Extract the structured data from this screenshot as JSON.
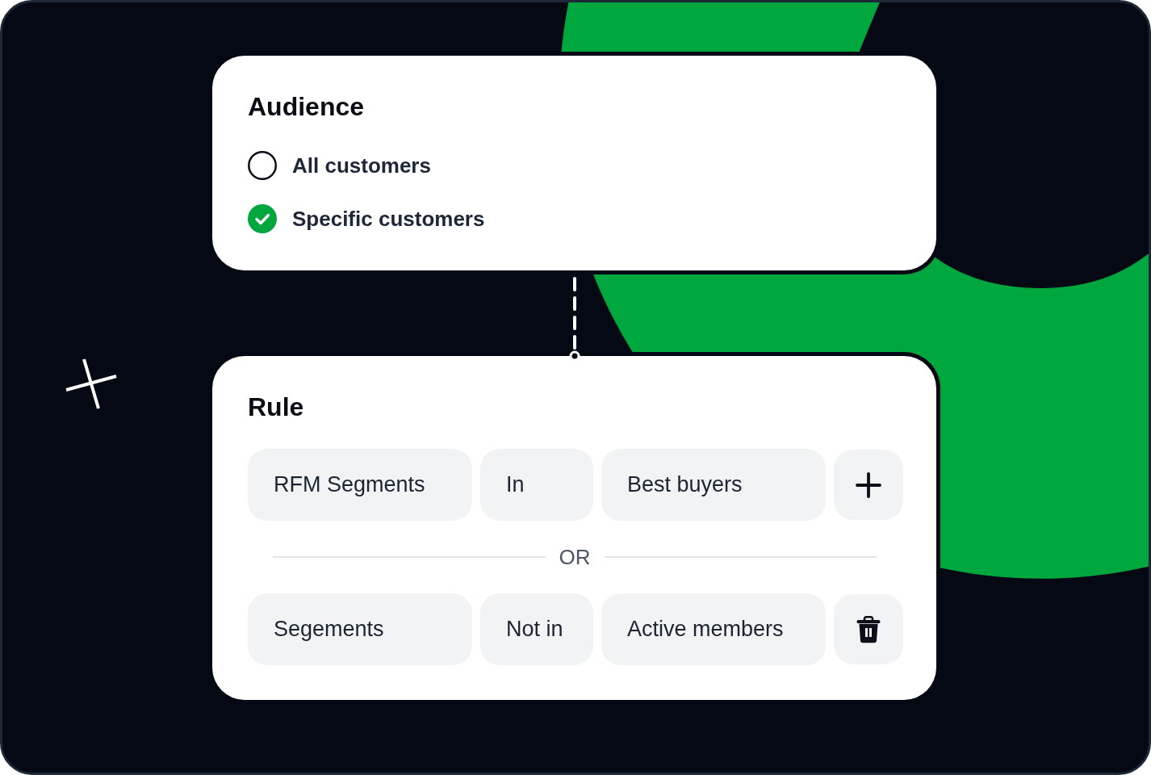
{
  "audience": {
    "title": "Audience",
    "options": [
      {
        "label": "All customers",
        "selected": false
      },
      {
        "label": "Specific customers",
        "selected": true
      }
    ]
  },
  "rule": {
    "title": "Rule",
    "separator": "OR",
    "conditions": [
      {
        "field": "RFM Segments",
        "operator": "In",
        "value": "Best buyers",
        "button": {
          "kind": "add"
        }
      },
      {
        "field": "Segements",
        "operator": "Not in",
        "value": "Active members",
        "button": {
          "kind": "delete"
        }
      }
    ]
  }
}
